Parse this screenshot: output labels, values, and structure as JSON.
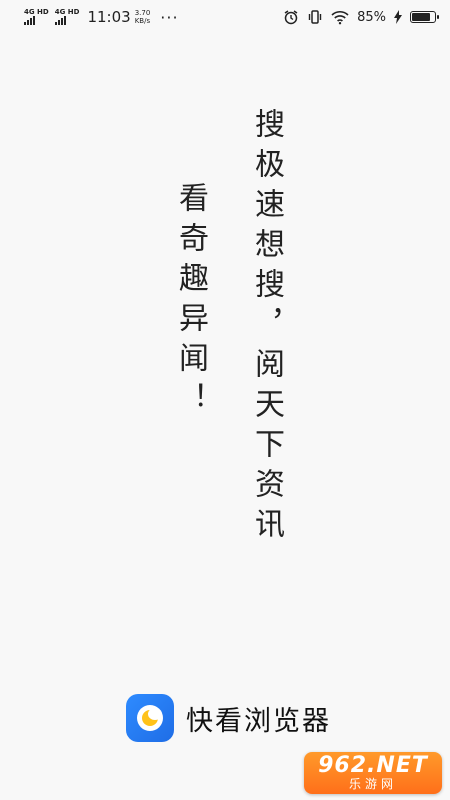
{
  "status_bar": {
    "network_1": "4G HD",
    "network_2": "4G HD",
    "time": "11:03",
    "speed_value": "3.70",
    "speed_unit": "KB/s",
    "overflow": "···",
    "battery_pct": "85%",
    "battery_level": 85
  },
  "splash": {
    "slogan_right": "搜极速想搜，阅天下资讯",
    "slogan_left": "看奇趣异闻！"
  },
  "brand": {
    "app_name": "快看浏览器",
    "logo_colors": {
      "background": "#1f6de6",
      "accent": "#ffc21a"
    }
  },
  "watermark": {
    "top": "962.NET",
    "bottom": "乐游网"
  }
}
